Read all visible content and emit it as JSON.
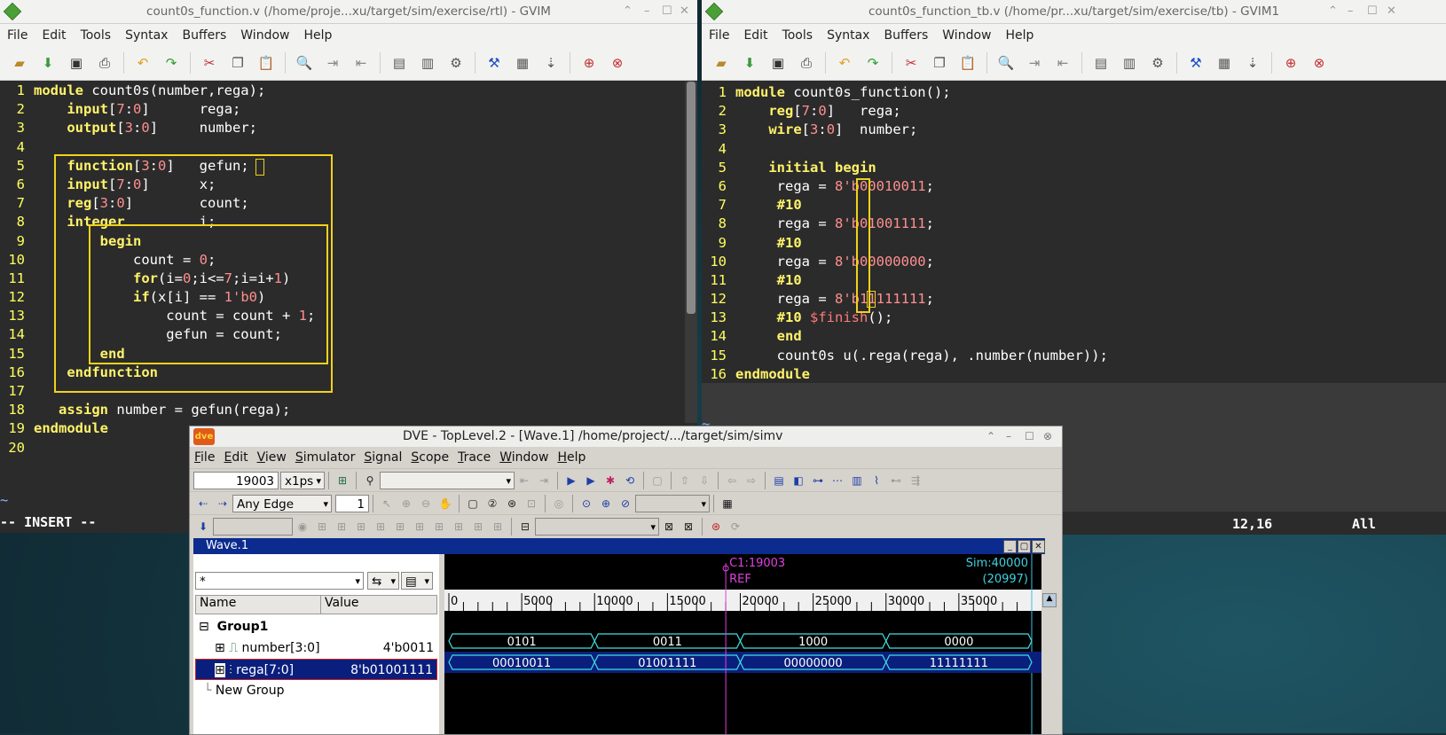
{
  "left_vim": {
    "title": "count0s_function.v (/home/proje...xu/target/sim/exercise/rtl) - GVIM",
    "menu": [
      "File",
      "Edit",
      "Tools",
      "Syntax",
      "Buffers",
      "Window",
      "Help"
    ],
    "mode": "-- INSERT --",
    "lines": [
      {
        "n": "1",
        "t": "module count0s(number,rega);"
      },
      {
        "n": "2",
        "t": "    input[7:0]      rega;"
      },
      {
        "n": "3",
        "t": "    output[3:0]     number;"
      },
      {
        "n": "4",
        "t": ""
      },
      {
        "n": "5",
        "t": "    function[3:0]   gefun;"
      },
      {
        "n": "6",
        "t": "    input[7:0]      x;"
      },
      {
        "n": "7",
        "t": "    reg[3:0]        count;"
      },
      {
        "n": "8",
        "t": "    integer         i;"
      },
      {
        "n": "9",
        "t": "        begin"
      },
      {
        "n": "10",
        "t": "            count = 0;"
      },
      {
        "n": "11",
        "t": "            for(i=0;i<=7;i=i+1)"
      },
      {
        "n": "12",
        "t": "            if(x[i] == 1'b0)"
      },
      {
        "n": "13",
        "t": "                count = count + 1;"
      },
      {
        "n": "14",
        "t": "                gefun = count;"
      },
      {
        "n": "15",
        "t": "        end"
      },
      {
        "n": "16",
        "t": "    endfunction"
      },
      {
        "n": "17",
        "t": ""
      },
      {
        "n": "18",
        "t": "   assign number = gefun(rega);"
      },
      {
        "n": "19",
        "t": "endmodule"
      },
      {
        "n": "20",
        "t": ""
      }
    ]
  },
  "right_vim": {
    "title": "count0s_function_tb.v (/home/pr...xu/target/sim/exercise/tb) - GVIM1",
    "menu": [
      "File",
      "Edit",
      "Tools",
      "Syntax",
      "Buffers",
      "Window",
      "Help"
    ],
    "position": "12,16",
    "scroll": "All",
    "lines": [
      {
        "n": "1",
        "t": "module count0s_function();"
      },
      {
        "n": "2",
        "t": "    reg[7:0]   rega;"
      },
      {
        "n": "3",
        "t": "    wire[3:0]  number;"
      },
      {
        "n": "4",
        "t": ""
      },
      {
        "n": "5",
        "t": "    initial begin"
      },
      {
        "n": "6",
        "t": "     rega = 8'b00010011;"
      },
      {
        "n": "7",
        "t": "     #10"
      },
      {
        "n": "8",
        "t": "     rega = 8'b01001111;"
      },
      {
        "n": "9",
        "t": "     #10"
      },
      {
        "n": "10",
        "t": "     rega = 8'b00000000;"
      },
      {
        "n": "11",
        "t": "     #10"
      },
      {
        "n": "12",
        "t": "     rega = 8'b11111111;"
      },
      {
        "n": "13",
        "t": "     #10 $finish();"
      },
      {
        "n": "14",
        "t": "     end"
      },
      {
        "n": "15",
        "t": "     count0s u(.rega(rega), .number(number));"
      },
      {
        "n": "16",
        "t": "endmodule"
      }
    ]
  },
  "dve": {
    "title": "DVE - TopLevel.2 - [Wave.1]  /home/project/.../target/sim/simv",
    "menu": [
      "File",
      "Edit",
      "View",
      "Simulator",
      "Signal",
      "Scope",
      "Trace",
      "Window",
      "Help"
    ],
    "time_value": "19003",
    "time_unit": "x1ps",
    "edge": "Any Edge",
    "step": "1",
    "wave_title": "Wave.1",
    "filter": "*",
    "col_name": "Name",
    "col_value": "Value",
    "cursor_label": "C1:19003",
    "ref_label": "REF",
    "sim_label": "Sim:40000",
    "sim_sub": "(20997)",
    "ticks": [
      "0",
      "5000",
      "10000",
      "15000",
      "20000",
      "25000",
      "30000",
      "35000"
    ],
    "group": "Group1",
    "new_group": "New Group",
    "signals": [
      {
        "name": "number[3:0]",
        "value": "4'b0011",
        "segments": [
          "0101",
          "0011",
          "1000",
          "0000"
        ]
      },
      {
        "name": "rega[7:0]",
        "value": "8'b01001111",
        "segments": [
          "00010011",
          "01001111",
          "00000000",
          "11111111"
        ]
      }
    ],
    "time_range": [
      0,
      40000
    ],
    "cursor_time": 19003,
    "segment_times": [
      0,
      10000,
      20000,
      30000,
      40000
    ]
  }
}
